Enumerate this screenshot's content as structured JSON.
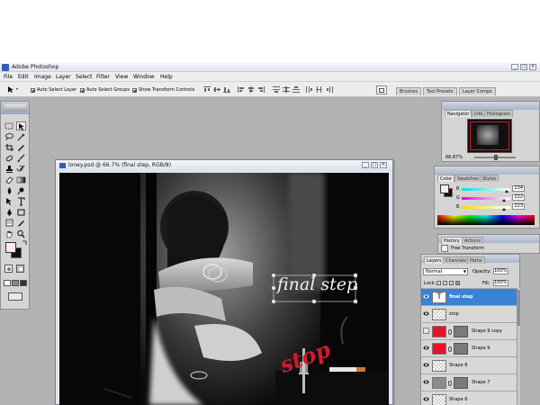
{
  "window": {
    "title": "Adobe Photoshop",
    "minimize": "_",
    "maximize": "□",
    "close": "×"
  },
  "menu": [
    "File",
    "Edit",
    "Image",
    "Layer",
    "Select",
    "Filter",
    "View",
    "Window",
    "Help"
  ],
  "options": {
    "auto_select_layer": "Auto Select Layer",
    "auto_select_groups": "Auto Select Groups",
    "show_transform_controls": "Show Transform Controls",
    "well_tabs": [
      "Brushes",
      "Tool Presets",
      "Layer Comps"
    ]
  },
  "document": {
    "title": "loney.psd @ 66.7% (final step, RGB/8)",
    "text_layer": "final step",
    "red_text": "stop"
  },
  "navigator": {
    "tabs": [
      "Navigator",
      "Info",
      "Histogram"
    ],
    "zoom": "66.67%"
  },
  "color_panel": {
    "tabs": [
      "Color",
      "Swatches",
      "Styles"
    ],
    "channels": [
      {
        "label": "R",
        "value": "234",
        "fraction": 0.918
      },
      {
        "label": "G",
        "value": "222",
        "fraction": 0.871
      },
      {
        "label": "B",
        "value": "223",
        "fraction": 0.875
      }
    ]
  },
  "history_panel": {
    "tabs": [
      "History",
      "Actions"
    ],
    "last_item": "Free Transform"
  },
  "layers_panel": {
    "tabs": [
      "Layers",
      "Channels",
      "Paths"
    ],
    "blend_mode": "Normal",
    "opacity_label": "Opacity:",
    "opacity_value": "100%",
    "lock_label": "Lock:",
    "fill_label": "Fill:",
    "fill_value": "100%",
    "layers": [
      {
        "name": "final step",
        "kind": "text",
        "selected": true,
        "visible": true
      },
      {
        "name": "stop",
        "kind": "transparent",
        "selected": false,
        "visible": true
      },
      {
        "name": "Shape 9 copy",
        "kind": "red-shape",
        "selected": false,
        "visible": false
      },
      {
        "name": "Shape 9",
        "kind": "red-shape",
        "selected": false,
        "visible": true
      },
      {
        "name": "Shape 8",
        "kind": "transparent",
        "selected": false,
        "visible": true
      },
      {
        "name": "Shape 7",
        "kind": "gray-shape",
        "selected": false,
        "visible": true
      },
      {
        "name": "Shape 6",
        "kind": "transparent",
        "selected": false,
        "visible": true
      }
    ]
  },
  "colors": {
    "accent": "#3a83d4",
    "foreground": "#fde9e7",
    "background": "#111111",
    "red_layer": "#e8102a"
  }
}
